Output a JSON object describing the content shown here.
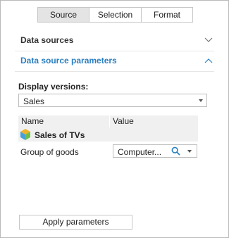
{
  "tabs": [
    {
      "label": "Source",
      "active": true
    },
    {
      "label": "Selection",
      "active": false
    },
    {
      "label": "Format",
      "active": false
    }
  ],
  "sections": {
    "data_sources": {
      "title": "Data sources",
      "expanded": false,
      "icon": "chevron-down-icon"
    },
    "data_source_parameters": {
      "title": "Data source parameters",
      "expanded": true,
      "icon": "chevron-up-icon",
      "accent": "#2a7fc0"
    }
  },
  "display_versions": {
    "label": "Display versions:",
    "selected": "Sales"
  },
  "grid": {
    "columns": [
      "Name",
      "Value"
    ],
    "source_row": {
      "icon": "cube-icon",
      "name": "Sales of TVs"
    },
    "params": [
      {
        "name": "Group of goods",
        "value": "Computer..."
      }
    ]
  },
  "apply_button": {
    "label": "Apply parameters"
  }
}
